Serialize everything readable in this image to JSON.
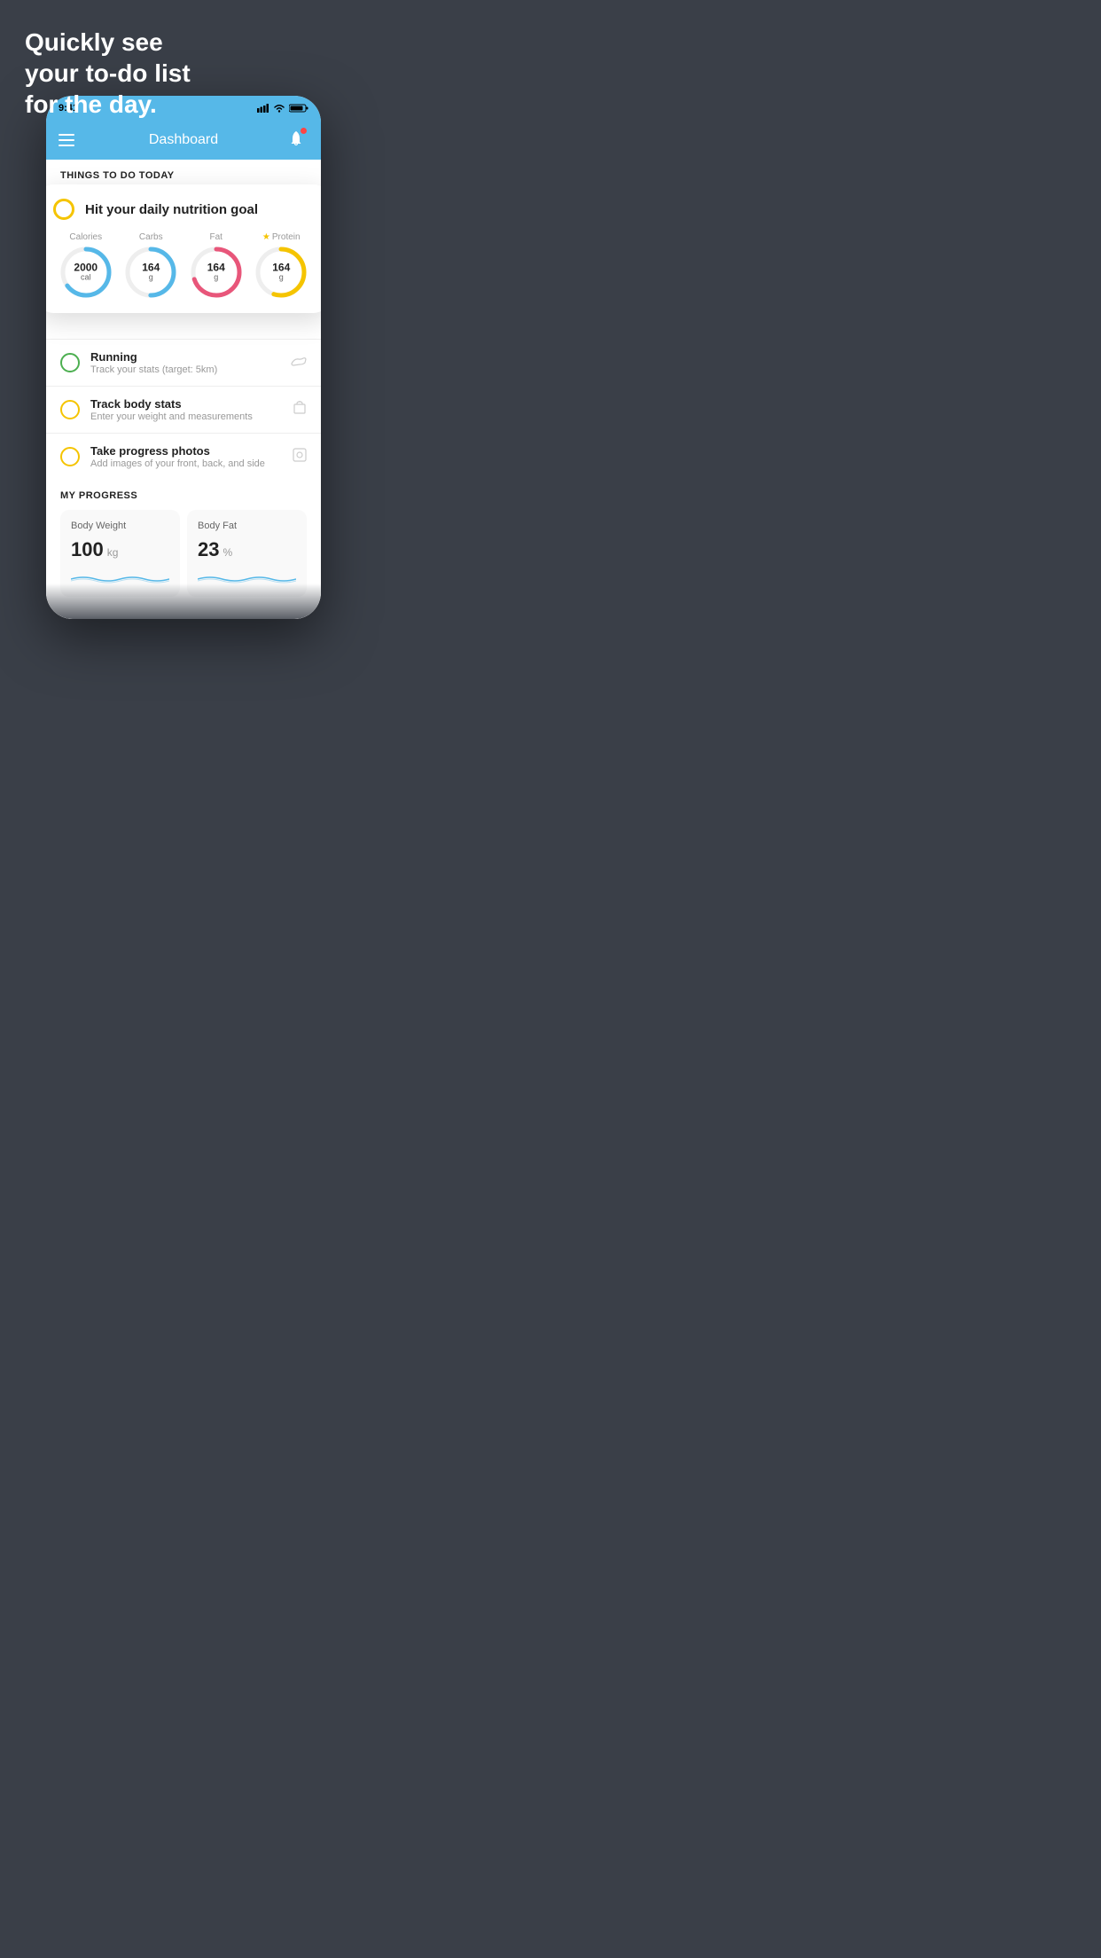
{
  "headline": {
    "line1": "Quickly see",
    "line2": "your to-do list",
    "line3": "for the day."
  },
  "status_bar": {
    "time": "9:41",
    "icons": "▌▌▌ ▲ ▮▮"
  },
  "header": {
    "title": "Dashboard"
  },
  "sections": {
    "things_today": "THINGS TO DO TODAY",
    "my_progress": "MY PROGRESS"
  },
  "nutrition_card": {
    "goal_text": "Hit your daily nutrition goal",
    "nutrients": [
      {
        "label": "Calories",
        "value": "2000",
        "unit": "cal",
        "color": "#56b8e8",
        "track_pct": 65,
        "starred": false
      },
      {
        "label": "Carbs",
        "value": "164",
        "unit": "g",
        "color": "#56b8e8",
        "track_pct": 50,
        "starred": false
      },
      {
        "label": "Fat",
        "value": "164",
        "unit": "g",
        "color": "#e8567a",
        "track_pct": 70,
        "starred": false
      },
      {
        "label": "Protein",
        "value": "164",
        "unit": "g",
        "color": "#f5c400",
        "track_pct": 55,
        "starred": true
      }
    ]
  },
  "todo_items": [
    {
      "title": "Running",
      "sub": "Track your stats (target: 5km)",
      "circle": "green",
      "icon": "👟"
    },
    {
      "title": "Track body stats",
      "sub": "Enter your weight and measurements",
      "circle": "yellow",
      "icon": "⚖"
    },
    {
      "title": "Take progress photos",
      "sub": "Add images of your front, back, and side",
      "circle": "yellow",
      "icon": "🖼"
    }
  ],
  "progress_cards": [
    {
      "title": "Body Weight",
      "value": "100",
      "unit": "kg"
    },
    {
      "title": "Body Fat",
      "value": "23",
      "unit": "%"
    }
  ]
}
